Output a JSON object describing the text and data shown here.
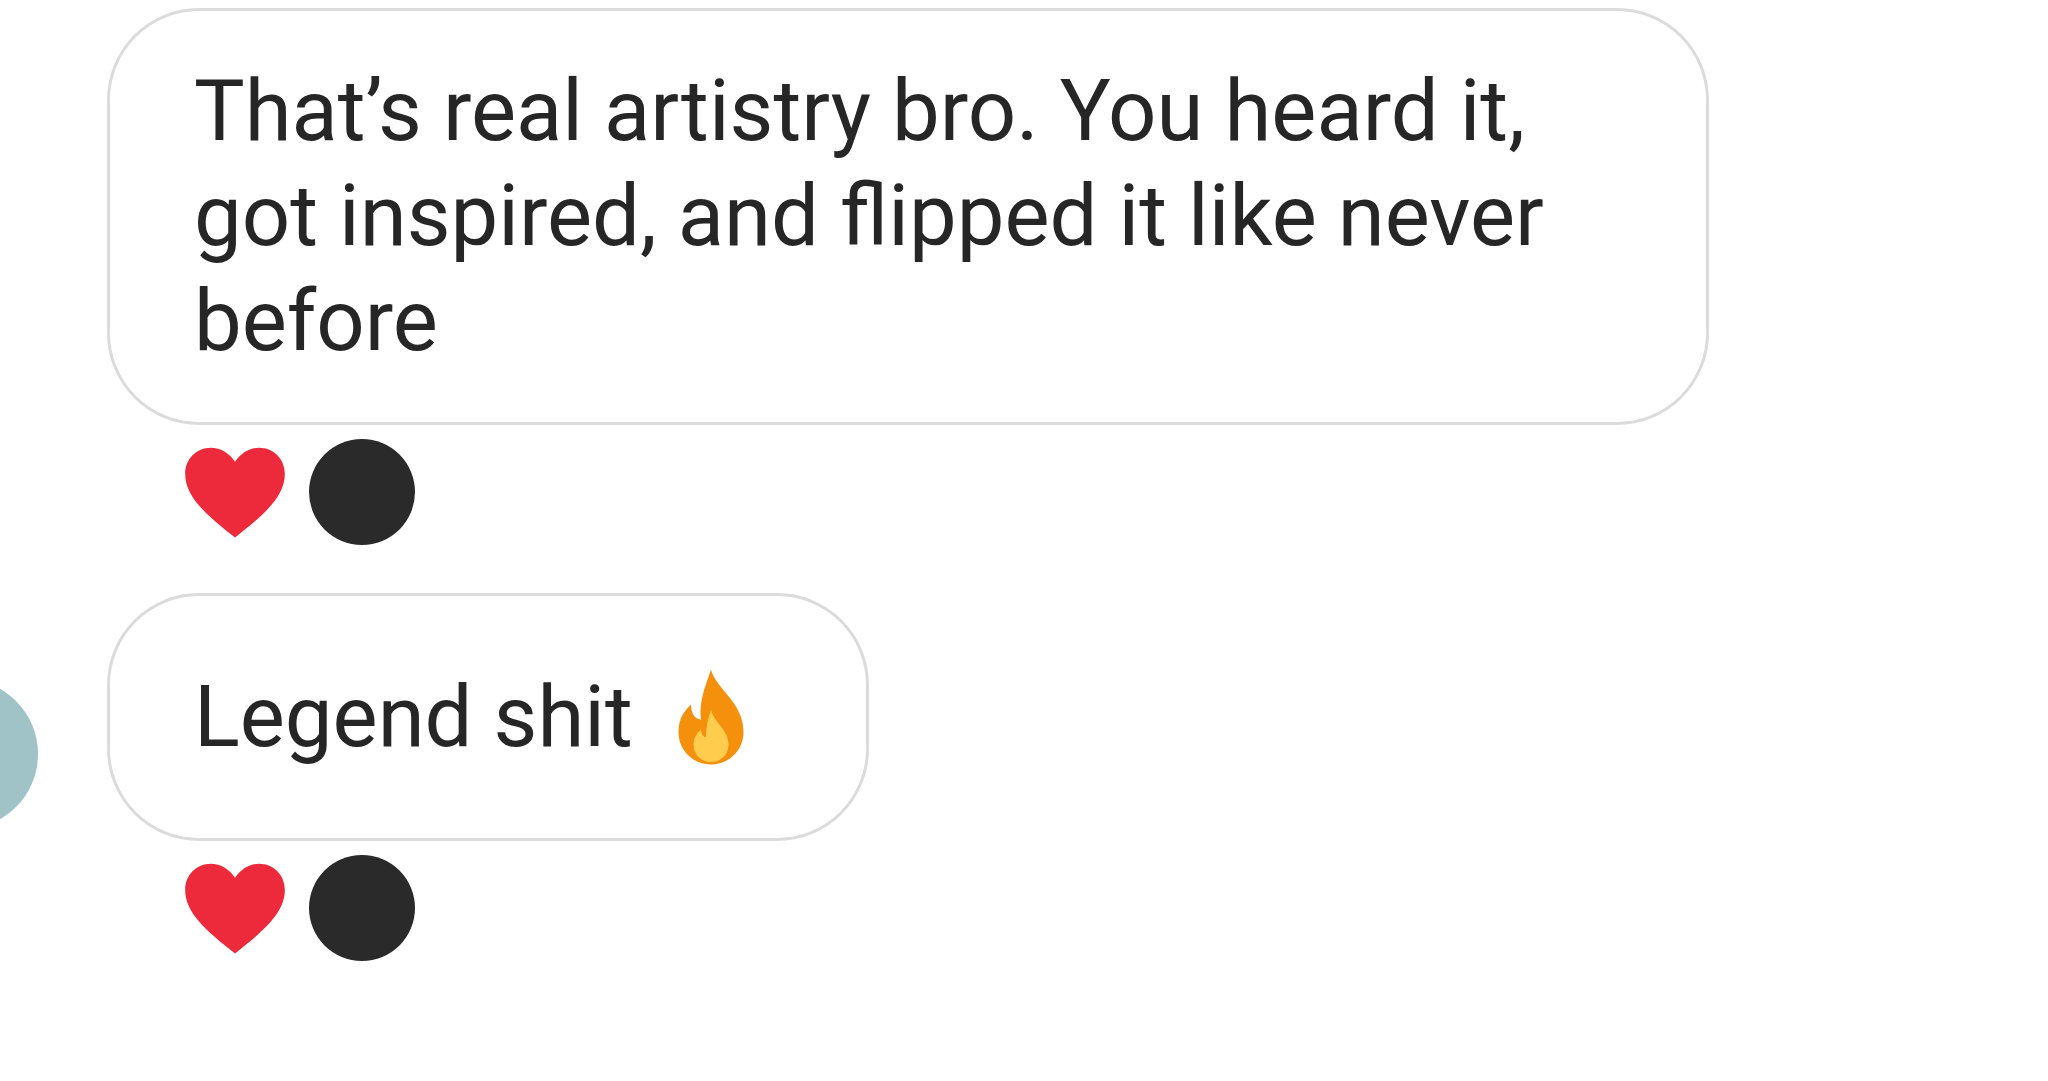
{
  "messages": [
    {
      "text": "That’s real artistry bro. You heard it, got inspired, and flipped it like never before",
      "sender_avatar": false,
      "reactions": [
        {
          "kind": "heart"
        }
      ]
    },
    {
      "text": "Legend shit",
      "icons": [
        {
          "kind": "fire"
        }
      ],
      "sender_avatar": true,
      "reactions": [
        {
          "kind": "heart"
        }
      ]
    }
  ]
}
